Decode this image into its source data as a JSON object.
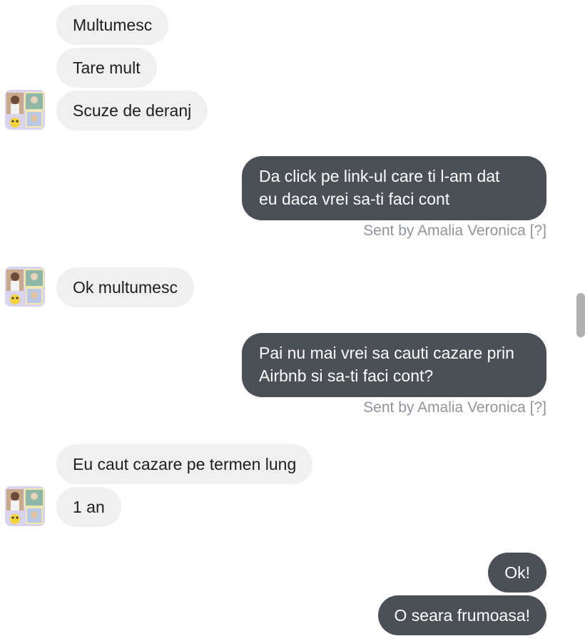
{
  "conversation": {
    "group1": {
      "messages": [
        "Multumesc",
        "Tare mult",
        "Scuze de deranj"
      ]
    },
    "out1": {
      "line1": "Da click pe link-ul care ti l-am dat",
      "line2": "eu daca vrei sa-ti faci cont",
      "sent_by": "Sent by Amalia Veronica",
      "help": "[?]"
    },
    "group2": {
      "messages": [
        "Ok multumesc"
      ]
    },
    "out2": {
      "line1": "Pai nu mai vrei sa cauti cazare prin",
      "line2": "Airbnb si sa-ti faci cont?",
      "sent_by": "Sent by Amalia Veronica",
      "help": "[?]"
    },
    "group3": {
      "messages": [
        "Eu caut cazare pe termen lung",
        "1 an"
      ]
    },
    "out3": {
      "messages": [
        "Ok!",
        "O seara frumoasa!"
      ]
    }
  },
  "avatar_icon": "profile-photo-collage",
  "colors": {
    "incoming_bubble": "#f0f0f0",
    "outgoing_bubble": "#4b4f56",
    "meta_text": "#90949c"
  }
}
